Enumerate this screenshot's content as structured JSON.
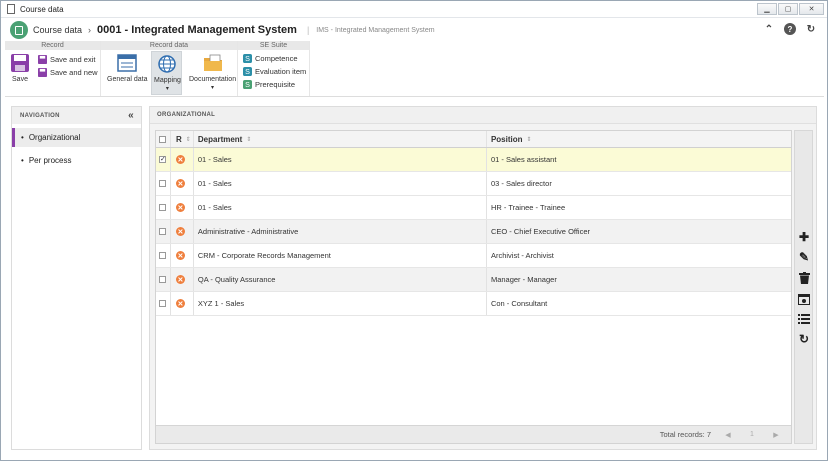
{
  "window": {
    "title": "Course data"
  },
  "header": {
    "breadcrumb_root": "Course data",
    "record_title": "0001 - Integrated Management System",
    "subtitle": "IMS - Integrated Management System"
  },
  "ribbon": {
    "groups": {
      "record": "Record",
      "record_data": "Record data",
      "se_suite": "SE Suite"
    },
    "save": "Save",
    "save_and_exit": "Save and exit",
    "save_and_new": "Save and new",
    "general_data": "General data",
    "mapping": "Mapping",
    "documentation": "Documentation",
    "competence": "Competence",
    "evaluation_item": "Evaluation item",
    "prerequisite": "Prerequisite"
  },
  "navigation": {
    "title": "NAVIGATION",
    "items": [
      {
        "label": "Organizational",
        "active": true
      },
      {
        "label": "Per process",
        "active": false
      }
    ]
  },
  "main": {
    "title": "ORGANIZATIONAL",
    "columns": {
      "r": "R",
      "department": "Department",
      "position": "Position"
    },
    "rows": [
      {
        "department": "01 - Sales",
        "position": "01 - Sales assistant",
        "checked": true
      },
      {
        "department": "01 - Sales",
        "position": "03 - Sales director",
        "checked": false
      },
      {
        "department": "01 - Sales",
        "position": "HR - Trainee - Trainee",
        "checked": false
      },
      {
        "department": "Administrative - Administrative",
        "position": "CEO - Chief Executive Officer",
        "checked": false
      },
      {
        "department": "CRM - Corporate Records Management",
        "position": "Archivist - Archivist",
        "checked": false
      },
      {
        "department": "QA - Quality Assurance",
        "position": "Manager - Manager",
        "checked": false
      },
      {
        "department": "XYZ 1 - Sales",
        "position": "Con - Consultant",
        "checked": false
      }
    ],
    "total_records": "Total records: 7"
  },
  "colors": {
    "accent": "#8a3fa8",
    "app_icon": "#4aa173",
    "row_icon": "#ef7f3d",
    "selected_row": "#fbfbd6"
  }
}
